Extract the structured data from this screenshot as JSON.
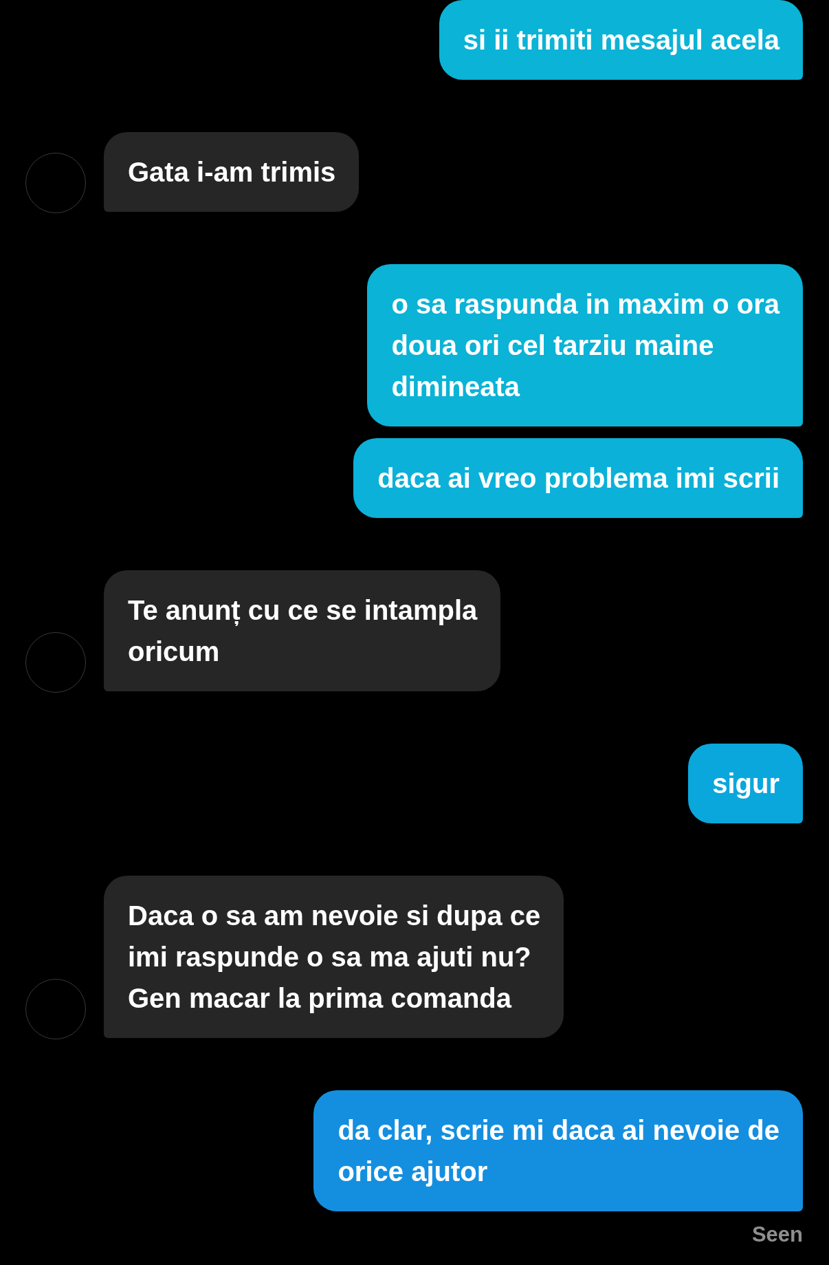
{
  "messages": [
    {
      "kind": "sent",
      "text": "si ii trimiti mesajul acela",
      "color": "#0bb3d6"
    },
    {
      "kind": "received",
      "text": "Gata i-am trimis"
    },
    {
      "kind": "sent",
      "text": "o sa raspunda in maxim o ora\ndoua ori cel tarziu maine\ndimineata",
      "color": "#0bb3d6"
    },
    {
      "kind": "sent",
      "text": "daca ai vreo problema imi scrii",
      "color": "#0bb1d8"
    },
    {
      "kind": "received",
      "text": "Te anunț cu ce se intampla\noricum"
    },
    {
      "kind": "sent",
      "text": "sigur",
      "color": "#0aa7dc"
    },
    {
      "kind": "received",
      "text": "Daca o sa am nevoie si dupa ce\nimi raspunde o sa ma ajuti nu?\nGen macar la prima comanda"
    },
    {
      "kind": "sent",
      "text": "da clar, scrie mi daca ai nevoie de\norice ajutor",
      "color": "#148fe0"
    }
  ],
  "status": "Seen"
}
